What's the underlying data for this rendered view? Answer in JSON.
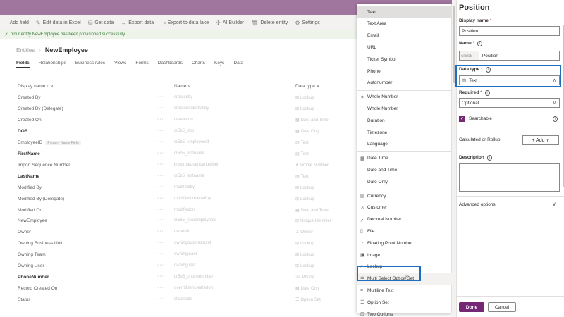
{
  "command_bar": [
    {
      "icon": "plus-icon",
      "glyph": "+",
      "label": "Add field"
    },
    {
      "icon": "edit-icon",
      "glyph": "✎",
      "label": "Edit data in Excel"
    },
    {
      "icon": "database-icon",
      "glyph": "⛁",
      "label": "Get data"
    },
    {
      "icon": "export-icon",
      "glyph": "→",
      "label": "Export data"
    },
    {
      "icon": "export-icon",
      "glyph": "⇥",
      "label": "Export to data lake"
    },
    {
      "icon": "ai-icon",
      "glyph": "✣",
      "label": "AI Builder"
    },
    {
      "icon": "delete-icon",
      "glyph": "🗑",
      "label": "Delete entity"
    },
    {
      "icon": "gear-icon",
      "glyph": "⚙",
      "label": "Settings"
    }
  ],
  "notification": "Your entity NewEmployee has been provisioned successfully.",
  "breadcrumb": {
    "root": "Entities",
    "current": "NewEmployee"
  },
  "tabs": [
    "Fields",
    "Relationships",
    "Business rules",
    "Views",
    "Forms",
    "Dashboards",
    "Charts",
    "Keys",
    "Data"
  ],
  "table": {
    "headers": {
      "display_name": "Display name ↑ ∨",
      "name": "Name ∨",
      "data_type": "Data type ∨"
    },
    "rows": [
      {
        "display": "Created By",
        "bold": false,
        "name": "createdby",
        "type": "Lookup"
      },
      {
        "display": "Created By (Delegate)",
        "bold": false,
        "name": "createdonbehalfby",
        "type": "Lookup"
      },
      {
        "display": "Created On",
        "bold": false,
        "name": "createdon",
        "type": "Date and Time"
      },
      {
        "display": "DOB",
        "bold": true,
        "name": "cr5b5_dob",
        "type": "Date Only"
      },
      {
        "display": "EmployeeID",
        "bold": false,
        "badge": "Primary Name Field",
        "name": "cr5b5_employeeid",
        "type": "Text"
      },
      {
        "display": "FirstName",
        "bold": true,
        "name": "cr5b5_firstname",
        "type": "Text"
      },
      {
        "display": "Import Sequence Number",
        "bold": false,
        "name": "importsequencenumber",
        "type": "Whole Number"
      },
      {
        "display": "LastName",
        "bold": true,
        "name": "cr5b5_lastname",
        "type": "Text"
      },
      {
        "display": "Modified By",
        "bold": false,
        "name": "modifiedby",
        "type": "Lookup"
      },
      {
        "display": "Modified By (Delegate)",
        "bold": false,
        "name": "modifiedonbehalfby",
        "type": "Lookup"
      },
      {
        "display": "Modified On",
        "bold": false,
        "name": "modifiedon",
        "type": "Date and Time"
      },
      {
        "display": "NewEmployee",
        "bold": false,
        "name": "cr5b5_newemployeeid",
        "type": "Unique Identifier"
      },
      {
        "display": "Owner",
        "bold": false,
        "name": "ownerid",
        "type": "Owner"
      },
      {
        "display": "Owning Business Unit",
        "bold": false,
        "name": "owningbusinessunit",
        "type": "Lookup"
      },
      {
        "display": "Owning Team",
        "bold": false,
        "name": "owningteam",
        "type": "Lookup"
      },
      {
        "display": "Owning User",
        "bold": false,
        "name": "owninguser",
        "type": "Lookup"
      },
      {
        "display": "PhoneNumber",
        "bold": true,
        "name": "cr5b5_phonenumber",
        "type": "Phone"
      },
      {
        "display": "Record Created On",
        "bold": false,
        "name": "overriddencreatedon",
        "type": "Date Only"
      },
      {
        "display": "Status",
        "bold": false,
        "name": "statecode",
        "type": "Option Set"
      }
    ]
  },
  "datatype_dropdown": [
    {
      "kind": "sub",
      "label": "Text",
      "selected": true
    },
    {
      "kind": "sub",
      "label": "Text Area"
    },
    {
      "kind": "sub",
      "label": "Email"
    },
    {
      "kind": "sub",
      "label": "URL"
    },
    {
      "kind": "sub",
      "label": "Ticker Symbol"
    },
    {
      "kind": "sub",
      "label": "Phone"
    },
    {
      "kind": "sub",
      "label": "Autonumber"
    },
    {
      "kind": "sep"
    },
    {
      "kind": "grp",
      "icon": "number-icon",
      "glyph": "⁕",
      "label": "Whole Number"
    },
    {
      "kind": "sub",
      "label": "Whole Number"
    },
    {
      "kind": "sub",
      "label": "Duration"
    },
    {
      "kind": "sub",
      "label": "Timezone"
    },
    {
      "kind": "sub",
      "label": "Language"
    },
    {
      "kind": "sep"
    },
    {
      "kind": "grp",
      "icon": "calendar-icon",
      "glyph": "▦",
      "label": "Date Time"
    },
    {
      "kind": "sub",
      "label": "Date and Time"
    },
    {
      "kind": "sub",
      "label": "Date Only"
    },
    {
      "kind": "sep"
    },
    {
      "kind": "grp",
      "icon": "currency-icon",
      "glyph": "▤",
      "label": "Currency"
    },
    {
      "kind": "grp",
      "icon": "person-icon",
      "glyph": "♙",
      "label": "Customer"
    },
    {
      "kind": "grp",
      "icon": "decimal-icon",
      "glyph": "⋰",
      "label": "Decimal Number"
    },
    {
      "kind": "grp",
      "icon": "file-icon",
      "glyph": "▯",
      "label": "File"
    },
    {
      "kind": "grp",
      "icon": "float-icon",
      "glyph": "◔",
      "label": "Floating Point Number"
    },
    {
      "kind": "grp",
      "icon": "image-icon",
      "glyph": "▣",
      "label": "Image"
    },
    {
      "kind": "grp",
      "icon": "lookup-icon",
      "glyph": "⌕",
      "label": "Lookup"
    },
    {
      "kind": "grp",
      "icon": "list-icon",
      "glyph": "☰",
      "label": "Multi Select Option Set",
      "hover": true
    },
    {
      "kind": "grp",
      "icon": "multiline-icon",
      "glyph": "≡",
      "label": "Multiline Text"
    },
    {
      "kind": "grp",
      "icon": "optionset-icon",
      "glyph": "☰",
      "label": "Option Set"
    },
    {
      "kind": "grp",
      "icon": "toggle-icon",
      "glyph": "⊡",
      "label": "Two Options"
    }
  ],
  "panel": {
    "title": "Position",
    "display_name_label": "Display name",
    "display_name_value": "Position",
    "name_label": "Name",
    "name_prefix": "cr5b5_",
    "name_value": "Position",
    "data_type_label": "Data type",
    "data_type_value": "Text",
    "required_label": "Required",
    "required_value": "Optional",
    "searchable_label": "Searchable",
    "calc_label": "Calculated or Rollup",
    "add_label": "+ Add ∨",
    "description_label": "Description",
    "advanced_label": "Advanced options",
    "done_label": "Done",
    "cancel_label": "Cancel"
  },
  "colors": {
    "topbar": "#a0769f",
    "accent": "#742774",
    "highlight": "#1e6ebf"
  }
}
